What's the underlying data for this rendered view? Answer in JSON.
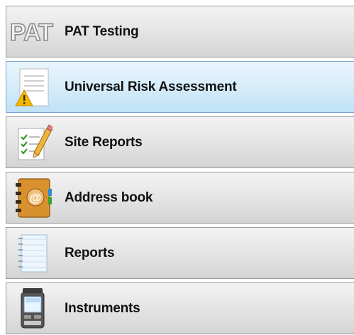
{
  "navigation": {
    "items": [
      {
        "label": "PAT Testing",
        "icon": "pat-logo-icon",
        "selected": false
      },
      {
        "label": "Universal Risk Assessment",
        "icon": "risk-assessment-icon",
        "selected": true
      },
      {
        "label": "Site Reports",
        "icon": "checklist-pencil-icon",
        "selected": false
      },
      {
        "label": "Address book",
        "icon": "address-book-icon",
        "selected": false
      },
      {
        "label": "Reports",
        "icon": "notepad-icon",
        "selected": false
      },
      {
        "label": "Instruments",
        "icon": "pat-tester-device-icon",
        "selected": false
      }
    ]
  },
  "logo_text": "PAT",
  "colors": {
    "selected_bg": "#d8eefb",
    "selected_border": "#7da2ce",
    "item_bg": "#e6e6e6",
    "warning_yellow": "#f5b800",
    "address_book_orange": "#d9902e"
  }
}
